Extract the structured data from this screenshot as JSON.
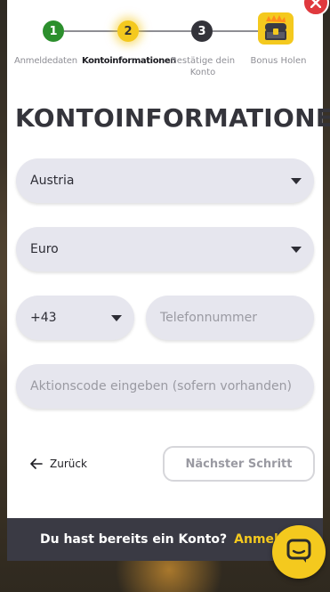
{
  "stepper": {
    "steps": [
      {
        "number": "1",
        "label": "Anmeldedaten",
        "status": "completed"
      },
      {
        "number": "2",
        "label": "Kontoinformationen",
        "status": "active"
      },
      {
        "number": "3",
        "label": "Bestätige dein Konto",
        "status": "pending"
      },
      {
        "number": "",
        "label": "Bonus Holen",
        "status": "pending"
      }
    ],
    "colors": {
      "completed": "#2c8f2d",
      "active": "#f4c91e",
      "pending": "#33333a"
    }
  },
  "page_title": "KONTOINFORMATIONEN",
  "form": {
    "country": {
      "value": "Austria"
    },
    "currency": {
      "value": "Euro"
    },
    "phone_prefix": {
      "value": "+43"
    },
    "phone_number": {
      "placeholder": "Telefonnummer"
    },
    "promo_code": {
      "placeholder": "Aktionscode eingeben (sofern vorhanden)"
    }
  },
  "actions": {
    "back_label": "Zurück",
    "next_label": "Nächster Schritt"
  },
  "login_bar": {
    "question": "Du hast bereits ein Konto?",
    "link_label": "Anmelden"
  },
  "icons": {
    "close": "close-icon",
    "bonus": "treasure-chest-icon",
    "back": "arrow-left-icon",
    "caret": "caret-down-icon",
    "chat": "chat-bubble-icon"
  },
  "colors": {
    "accent": "#f4c91e",
    "close": "#e0393e",
    "text": "#34343b",
    "field_bg": "#e6e6ee",
    "bar_bg": "#3a3a44"
  }
}
